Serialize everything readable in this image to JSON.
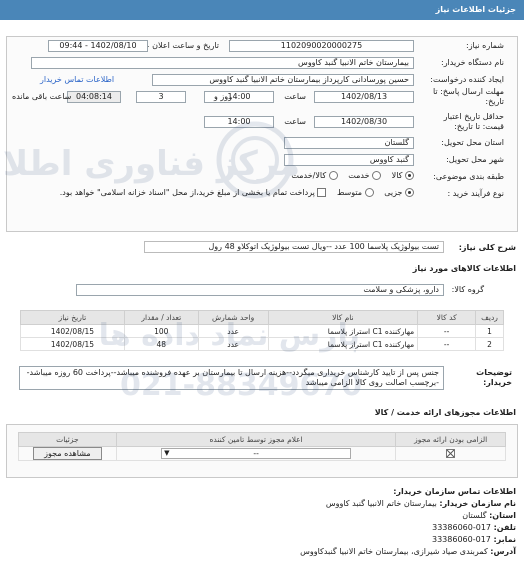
{
  "header": {
    "title": "جزئیات اطلاعات نیاز"
  },
  "form": {
    "need_number_label": "شماره نیاز:",
    "need_number": "1102090020000275",
    "announce_label": "تاریخ و ساعت اعلان عمومی:",
    "announce_value": "1402/08/10 - 09:44",
    "buyer_label": "نام دستگاه خریدار:",
    "buyer_value": "بیمارستان خاتم الانبیا گنبد کاووس",
    "creator_label": "ایجاد کننده درخواست:",
    "creator_value": "حسین پورسادانی کارپرداز بیمارستان خاتم الانبیا گنبد کاووس",
    "contact_link": "اطلاعات تماس خریدار",
    "deadline_label_1": "مهلت ارسال پاسخ: تا",
    "deadline_label_2": "تاریخ:",
    "deadline_date": "1402/08/13",
    "time_label": "ساعت",
    "deadline_time": "14:00",
    "days_value": "3",
    "days_label": "روز و",
    "remaining_time": "04:08:14",
    "remaining_label": "ساعت باقی مانده",
    "validity_label_1": "حداقل تاریخ اعتبار",
    "validity_label_2": "قیمت: تا تاریخ:",
    "validity_date": "1402/08/30",
    "validity_time": "14:00",
    "province_label": "استان محل تحویل:",
    "province_value": "گلستان",
    "city_label": "شهر محل تحویل:",
    "city_value": "گنبد کاووس",
    "category_label": "طبقه بندی موضوعی:",
    "category_options": [
      "کالا",
      "خدمت",
      "کالا/خدمت"
    ],
    "process_label": "نوع فرآیند خرید :",
    "process_options": [
      "جزیی",
      "متوسط"
    ],
    "payment_note": "پرداخت تمام یا بخشی از مبلغ خرید،از محل \"اسناد خزانه اسلامی\" خواهد بود."
  },
  "need": {
    "summary_label": "شرح کلی نیاز:",
    "summary_value": "تست بیولوژیک پلاسما 100 عدد --ویال تست بیولوژیک اتوکلاو 48 رول"
  },
  "goods": {
    "section_title": "اطلاعات کالاهای مورد نیاز",
    "group_label": "گروه کالا:",
    "group_value": "دارو، پزشکی و سلامت",
    "columns": [
      "ردیف",
      "کد کالا",
      "نام کالا",
      "واحد شمارش",
      "تعداد / مقدار",
      "تاریخ نیاز"
    ],
    "rows": [
      [
        "1",
        "--",
        "مهارکننده C1 استراز پلاسما",
        "عدد",
        "100",
        "1402/08/15"
      ],
      [
        "2",
        "--",
        "مهارکننده C1 استراز پلاسما",
        "عدد",
        "48",
        "1402/08/15"
      ]
    ],
    "buyer_notes_label_1": "توضیحات",
    "buyer_notes_label_2": "خریدار:",
    "buyer_notes": "جنس پس از تایید کارشناس خریداری میگردد--هزینه ارسال تا بیمارستان بر عهده فروشنده میباشد--پرداخت 60 روزه میباشد--برچسب اصالت روی کالا الزامی میباشد"
  },
  "permits": {
    "section_title": "اطلاعات مجوزهای ارائه خدمت / کالا",
    "columns": [
      "الزامی بودن ارائه مجوز",
      "اعلام مجوز توسط تامین کننده",
      "جزئیات"
    ],
    "select_value": "--",
    "view_button": "مشاهده مجوز"
  },
  "contact": {
    "title": "اطلاعات تماس سازمان خریدار:",
    "org_label": "نام سازمان خریدار:",
    "org_value": "بیمارستان خاتم الانبیا گنبد کاووس",
    "province_label": "استان:",
    "province_value": "گلستان",
    "phone_label": "تلفن:",
    "phone_value": "017-33386060",
    "fax_label": "نمابر:",
    "fax_value": "017-33386060",
    "address_label": "آدرس:",
    "address_value": "کمربندی صیاد شیرازی، بیمارستان خاتم الانبیا گنبدکاووس"
  },
  "watermark": {
    "text1": "مرکز فناوری اطلاعات",
    "text2": "پارس نماد داده ها",
    "phone": "021-88349670"
  },
  "colors": {
    "topbar": "#4a86b8",
    "link": "#2a64c8"
  }
}
